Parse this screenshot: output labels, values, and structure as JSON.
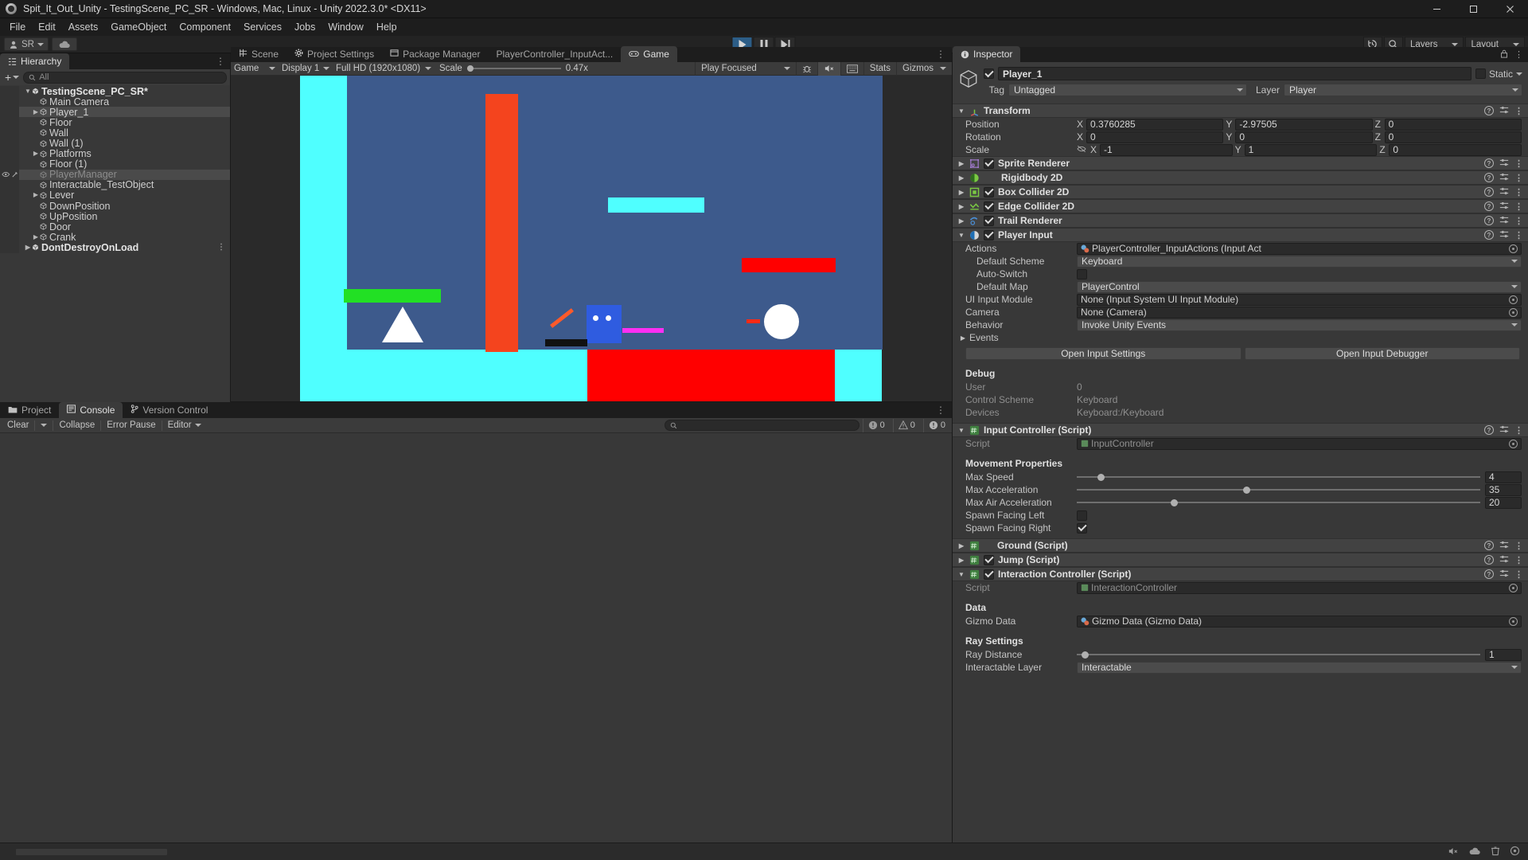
{
  "window": {
    "title": "Spit_It_Out_Unity - TestingScene_PC_SR - Windows, Mac, Linux - Unity 2022.3.0* <DX11>",
    "minimize_icon": "minimize-icon",
    "maximize_icon": "maximize-icon",
    "close_icon": "close-icon"
  },
  "menu": {
    "items": [
      "File",
      "Edit",
      "Assets",
      "GameObject",
      "Component",
      "Services",
      "Jobs",
      "Window",
      "Help"
    ]
  },
  "toolbar": {
    "account": "SR",
    "cloud_icon": "cloud-icon",
    "play_icon": "play-icon",
    "pause_icon": "pause-icon",
    "step_icon": "step-icon",
    "history_icon": "history-icon",
    "search_icon": "search-icon",
    "layers_label": "Layers",
    "layout_label": "Layout"
  },
  "hierarchy": {
    "tab": "Hierarchy",
    "tab_icon": "hierarchy-icon",
    "add_label": "+",
    "search_placeholder": "All",
    "search_icon": "search-icon",
    "items": [
      {
        "label": "TestingScene_PC_SR*",
        "depth": 0,
        "arrow": "down",
        "type": "scene",
        "selected": false,
        "dim": false
      },
      {
        "label": "Main Camera",
        "depth": 1,
        "arrow": "none",
        "type": "go",
        "selected": false,
        "dim": false
      },
      {
        "label": "Player_1",
        "depth": 1,
        "arrow": "right",
        "type": "go",
        "selected": true,
        "dim": false
      },
      {
        "label": "Floor",
        "depth": 1,
        "arrow": "none",
        "type": "go",
        "selected": false,
        "dim": false
      },
      {
        "label": "Wall",
        "depth": 1,
        "arrow": "none",
        "type": "go",
        "selected": false,
        "dim": false
      },
      {
        "label": "Wall (1)",
        "depth": 1,
        "arrow": "none",
        "type": "go",
        "selected": false,
        "dim": false
      },
      {
        "label": "Platforms",
        "depth": 1,
        "arrow": "right",
        "type": "go",
        "selected": false,
        "dim": false
      },
      {
        "label": "Floor (1)",
        "depth": 1,
        "arrow": "none",
        "type": "go",
        "selected": false,
        "dim": false
      },
      {
        "label": "PlayerManager",
        "depth": 1,
        "arrow": "none",
        "type": "go",
        "selected": true,
        "dim": true,
        "gutter": "visibility"
      },
      {
        "label": "Interactable_TestObject",
        "depth": 1,
        "arrow": "none",
        "type": "go",
        "selected": false,
        "dim": false
      },
      {
        "label": "Lever",
        "depth": 1,
        "arrow": "right",
        "type": "go",
        "selected": false,
        "dim": false
      },
      {
        "label": "DownPosition",
        "depth": 1,
        "arrow": "none",
        "type": "go",
        "selected": false,
        "dim": false
      },
      {
        "label": "UpPosition",
        "depth": 1,
        "arrow": "none",
        "type": "go",
        "selected": false,
        "dim": false
      },
      {
        "label": "Door",
        "depth": 1,
        "arrow": "none",
        "type": "go",
        "selected": false,
        "dim": false
      },
      {
        "label": "Crank",
        "depth": 1,
        "arrow": "right",
        "type": "go",
        "selected": false,
        "dim": false
      },
      {
        "label": "DontDestroyOnLoad",
        "depth": 0,
        "arrow": "right",
        "type": "scene",
        "selected": false,
        "dim": false,
        "rdots": true
      }
    ]
  },
  "center": {
    "tabs": [
      {
        "label": "Scene",
        "icon": "scene-icon",
        "active": false
      },
      {
        "label": "Project Settings",
        "icon": "gear-icon",
        "active": false
      },
      {
        "label": "Package Manager",
        "icon": "package-icon",
        "active": false
      },
      {
        "label": "PlayerController_InputAct...",
        "icon": "none",
        "active": false
      },
      {
        "label": "Game",
        "icon": "game-icon",
        "active": true
      }
    ],
    "game_toolbar": {
      "view_mode": "Game",
      "display": "Display 1",
      "resolution": "Full HD (1920x1080)",
      "scale_label": "Scale",
      "scale_value": "0.47x",
      "play_focused": "Play Focused",
      "mute_icon": "mute-audio-icon",
      "bug_icon": "bug-icon",
      "screenshot_icon": "screenshot-icon",
      "stats_label": "Stats",
      "gizmos_label": "Gizmos"
    }
  },
  "console": {
    "tabs": [
      {
        "label": "Project",
        "icon": "folder-icon",
        "active": false
      },
      {
        "label": "Console",
        "icon": "console-icon",
        "active": true
      },
      {
        "label": "Version Control",
        "icon": "branch-icon",
        "active": false
      }
    ],
    "clear_label": "Clear",
    "collapse_label": "Collapse",
    "error_pause_label": "Error Pause",
    "editor_label": "Editor",
    "search_icon": "search-icon",
    "search_value": "",
    "counts": {
      "log": "0",
      "warning": "0",
      "error": "0"
    }
  },
  "inspector": {
    "tab": "Inspector",
    "tab_icon": "info-icon",
    "lock_icon": "lock-icon",
    "menu_icon": "kebab-icon",
    "object": {
      "enabled": true,
      "name": "Player_1",
      "static_label": "Static",
      "static_checked": false,
      "tag_label": "Tag",
      "tag_value": "Untagged",
      "layer_label": "Layer",
      "layer_value": "Player"
    },
    "transform": {
      "title": "Transform",
      "icon": "transform-icon",
      "rows": [
        {
          "label": "Position",
          "x": "0.3760285",
          "y": "-2.97505",
          "z": "0"
        },
        {
          "label": "Rotation",
          "x": "0",
          "y": "0",
          "z": "0"
        },
        {
          "label": "Scale",
          "x": "-1",
          "y": "1",
          "z": "0",
          "link_icon": "constrain-off-icon"
        }
      ],
      "axes": [
        "X",
        "Y",
        "Z"
      ]
    },
    "components": [
      {
        "title": "Sprite Renderer",
        "icon": "sprite-renderer-icon",
        "enabled": true,
        "expanded": false,
        "has_checkbox": true
      },
      {
        "title": "Rigidbody 2D",
        "icon": "rigidbody2d-icon",
        "enabled": false,
        "expanded": false,
        "has_checkbox": false
      },
      {
        "title": "Box Collider 2D",
        "icon": "boxcollider2d-icon",
        "enabled": true,
        "expanded": false,
        "has_checkbox": true
      },
      {
        "title": "Edge Collider 2D",
        "icon": "edgecollider2d-icon",
        "enabled": true,
        "expanded": false,
        "has_checkbox": true
      },
      {
        "title": "Trail Renderer",
        "icon": "trail-renderer-icon",
        "enabled": true,
        "expanded": false,
        "has_checkbox": true
      },
      {
        "title": "Player Input",
        "icon": "player-input-icon",
        "enabled": true,
        "expanded": true,
        "has_checkbox": true
      }
    ],
    "player_input": {
      "actions_label": "Actions",
      "actions_value": "PlayerController_InputActions (Input Act",
      "default_scheme_label": "Default Scheme",
      "default_scheme_value": "Keyboard",
      "auto_switch_label": "Auto-Switch",
      "auto_switch_checked": false,
      "default_map_label": "Default Map",
      "default_map_value": "PlayerControl",
      "ui_input_module_label": "UI Input Module",
      "ui_input_module_value": "None (Input System UI Input Module)",
      "camera_label": "Camera",
      "camera_value": "None (Camera)",
      "behavior_label": "Behavior",
      "behavior_value": "Invoke Unity Events",
      "events_label": "Events",
      "open_input_settings": "Open Input Settings",
      "open_input_debugger": "Open Input Debugger",
      "debug_title": "Debug",
      "debug_rows": [
        {
          "label": "User",
          "value": "0"
        },
        {
          "label": "Control Scheme",
          "value": "Keyboard"
        },
        {
          "label": "Devices",
          "value": "Keyboard:/Keyboard"
        }
      ]
    },
    "input_controller": {
      "title": "Input Controller (Script)",
      "icon": "script-icon",
      "enabled": true,
      "expanded": true,
      "script_label": "Script",
      "script_value": "InputController",
      "movement_title": "Movement Properties",
      "sliders": [
        {
          "label": "Max Speed",
          "value": "4",
          "pct": 6
        },
        {
          "label": "Max Acceleration",
          "value": "35",
          "pct": 42
        },
        {
          "label": "Max Air Acceleration",
          "value": "20",
          "pct": 24
        }
      ],
      "spawn_left_label": "Spawn Facing Left",
      "spawn_left_checked": false,
      "spawn_right_label": "Spawn Facing Right",
      "spawn_right_checked": true
    },
    "ground_script": {
      "title": "Ground (Script)",
      "icon": "script-icon",
      "enabled": false,
      "expanded": false,
      "has_checkbox": false
    },
    "jump_script": {
      "title": "Jump (Script)",
      "icon": "script-icon",
      "enabled": true,
      "expanded": false,
      "has_checkbox": true
    },
    "interaction_controller": {
      "title": "Interaction Controller (Script)",
      "icon": "script-icon",
      "enabled": true,
      "expanded": true,
      "script_label": "Script",
      "script_value": "InteractionController",
      "data_title": "Data",
      "gizmo_data_label": "Gizmo Data",
      "gizmo_data_value": "Gizmo Data (Gizmo Data)",
      "ray_title": "Ray Settings",
      "ray_distance_label": "Ray Distance",
      "ray_distance_value": "1",
      "ray_distance_pct": 2,
      "interactable_layer_label": "Interactable Layer",
      "interactable_layer_value": "Interactable"
    }
  },
  "colors": {
    "accent_blue": "#2c5d87",
    "panel_bg": "#383838",
    "header_bg": "#424242",
    "game_cyan": "#4fffff",
    "game_navy": "#3d5a8c",
    "game_red": "#ff0000",
    "game_orange": "#f4441e",
    "game_green": "#22e024",
    "game_magenta": "#ff2ff4",
    "game_blue_player": "#2f5ce0"
  },
  "game_scene": {
    "description": "2D platformer game view: cyan background with navy play field, colored platforms and player character"
  },
  "statusbar": {
    "icons": [
      "sound-icon",
      "cloud-icon",
      "trash-icon",
      "settings-icon"
    ]
  }
}
